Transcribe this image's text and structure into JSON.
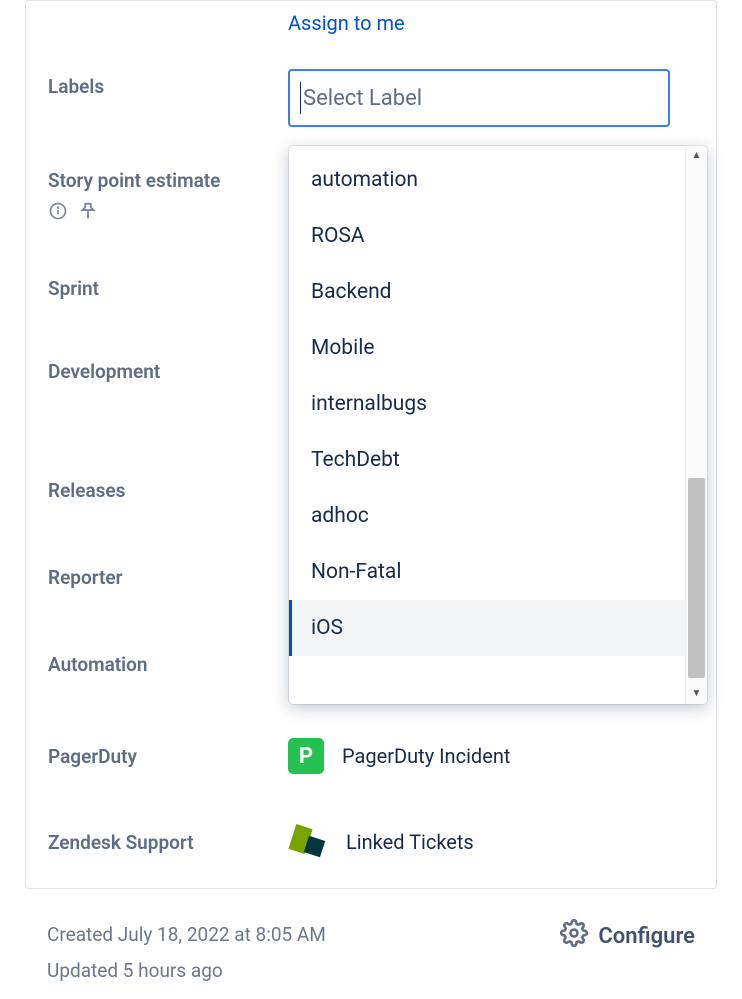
{
  "assign_link": "Assign to me",
  "labels": {
    "labels": "Labels",
    "story_points": "Story point estimate",
    "sprint": "Sprint",
    "development": "Development",
    "releases": "Releases",
    "reporter": "Reporter",
    "automation": "Automation",
    "pagerduty": "PagerDuty",
    "zendesk": "Zendesk Support"
  },
  "select": {
    "placeholder": "Select Label",
    "options": [
      "automation",
      "ROSA",
      "Backend",
      "Mobile",
      "internalbugs",
      "TechDebt",
      "adhoc",
      "Non-Fatal",
      "iOS"
    ],
    "highlighted_index": 8
  },
  "pagerduty": {
    "icon_letter": "P",
    "link": "PagerDuty Incident"
  },
  "zendesk": {
    "link": "Linked Tickets"
  },
  "footer": {
    "created": "Created July 18, 2022 at 8:05 AM",
    "updated": "Updated 5 hours ago",
    "configure": "Configure"
  }
}
